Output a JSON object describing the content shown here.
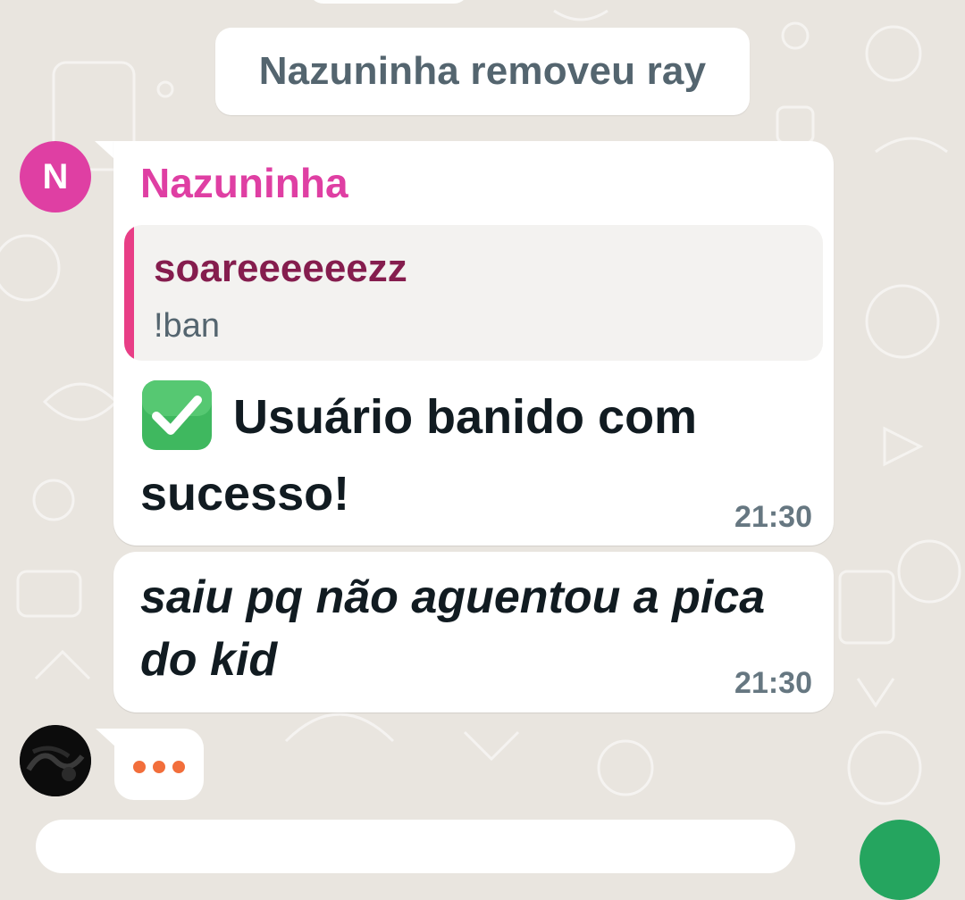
{
  "system_message": {
    "text": "Nazuninha removeu ray"
  },
  "messages": [
    {
      "avatar_initial": "N",
      "sender": "Nazuninha",
      "quote": {
        "author": "soareeeeeezz",
        "text": "!ban"
      },
      "icon": "check-mark-button-icon",
      "text": "Usuário banido com sucesso!",
      "time": "21:30"
    },
    {
      "text": "saiu pq não aguentou a pica do kid",
      "time": "21:30"
    }
  ],
  "typing_indicator": {
    "icon": "typing-dots-icon"
  },
  "colors": {
    "sender_name": "#df3fa3",
    "quote_bar": "#e83e86",
    "quote_author": "#851d4e",
    "typing_dots": "#f26e3b",
    "background": "#e9e5df"
  }
}
